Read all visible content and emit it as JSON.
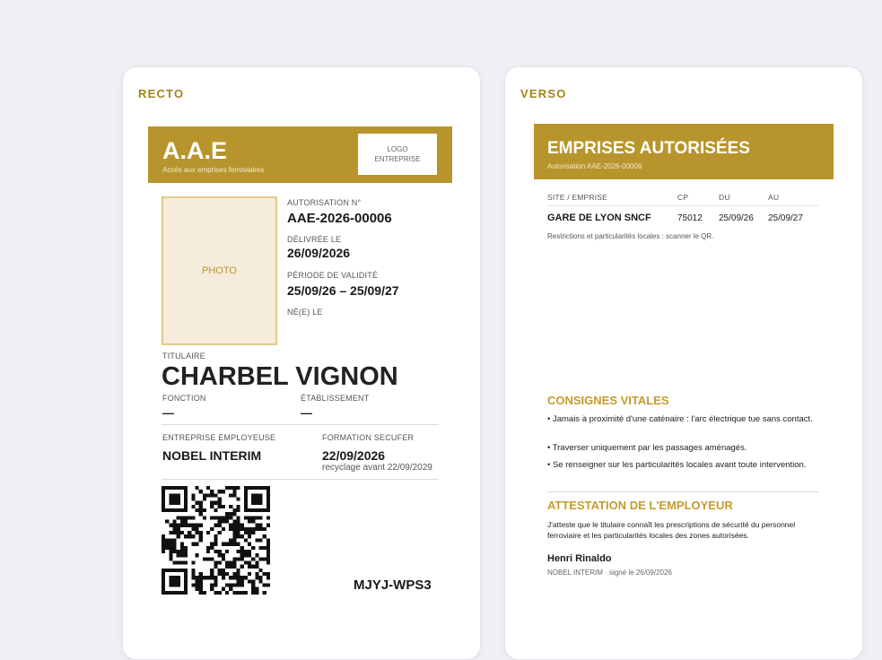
{
  "recto": {
    "heading": "RECTO",
    "title": "A.A.E",
    "subtitle": "Accès aux emprises ferroviaires",
    "logo_line1": "LOGO",
    "logo_line2": "ENTREPRISE",
    "photo_label": "PHOTO",
    "authorization_label": "AUTORISATION N°",
    "authorization_number": "AAE-2026-00006",
    "issued_label": "DÉLIVRÉE LE",
    "issued_date": "26/09/2026",
    "validity_label": "PÉRIODE DE VALIDITÉ",
    "validity_period": "25/09/26 – 25/09/27",
    "born_label": "NÉ(E) LE",
    "holder_label": "TITULAIRE",
    "holder_name": "CHARBEL VIGNON",
    "function_label": "FONCTION",
    "function_value": "—",
    "establishment_label": "ÉTABLISSEMENT",
    "establishment_value": "—",
    "employer_label": "ENTREPRISE EMPLOYEUSE",
    "employer_value": "NOBEL INTERIM",
    "training_label": "FORMATION SECUFER",
    "training_date": "22/09/2026",
    "training_note": "recyclage avant 22/09/2029",
    "code": "MJYJ-WPS3"
  },
  "verso": {
    "heading": "VERSO",
    "title": "EMPRISES AUTORISÉES",
    "subtitle": "Autorisation AAE-2026-00006",
    "table_headers": [
      "SITE / EMPRISE",
      "CP",
      "DU",
      "AU"
    ],
    "table_row": [
      "GARE DE LYON SNCF",
      "75012",
      "25/09/26",
      "25/09/27"
    ],
    "restrictions_note": "Restrictions et particularités locales : scanner le QR.",
    "vital_title": "CONSIGNES VITALES",
    "vital_items": [
      "• Jamais à proximité d'une caténaire : l'arc électrique tue sans contact.",
      "• Traverser uniquement par les passages aménagés.",
      "• Se renseigner sur les particularités locales avant toute intervention."
    ],
    "attestation_title": "ATTESTATION DE L'EMPLOYEUR",
    "attestation_text": "J'atteste que le titulaire connaît les prescriptions de sécurité du personnel ferroviaire et les particularités locales des zones autorisées.",
    "signer_name": "Henri Rinaldo",
    "signer_meta": "NOBEL INTERIM · signé le 26/09/2026"
  },
  "colors": {
    "gold": "#b8952c",
    "gold_text": "#a3831c",
    "photo_bg": "#f6ecdb"
  },
  "icons": {
    "qr": "qr-code-icon"
  }
}
